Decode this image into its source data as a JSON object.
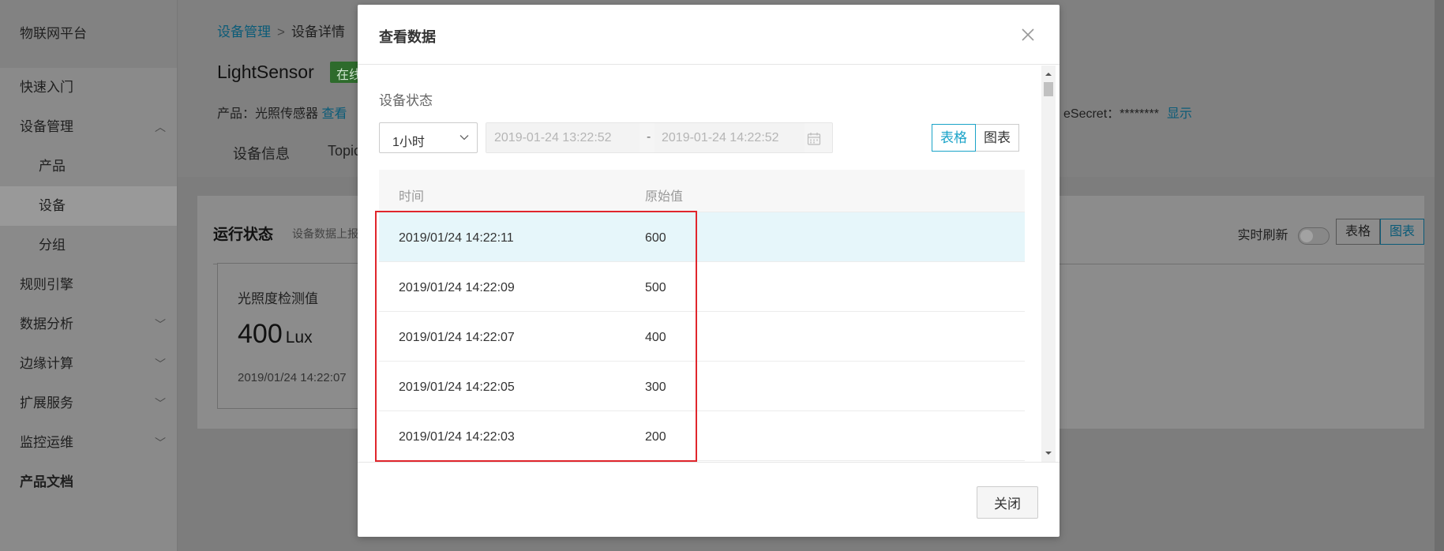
{
  "sidebar": {
    "brand": "物联网平台",
    "items": [
      {
        "label": "快速入门"
      },
      {
        "label": "设备管理"
      },
      {
        "label": "产品"
      },
      {
        "label": "设备"
      },
      {
        "label": "分组"
      },
      {
        "label": "规则引擎"
      },
      {
        "label": "数据分析"
      },
      {
        "label": "边缘计算"
      },
      {
        "label": "扩展服务"
      },
      {
        "label": "监控运维"
      },
      {
        "label": "产品文档"
      }
    ]
  },
  "page": {
    "breadcrumb_root": "设备管理",
    "breadcrumb_sep": ">",
    "breadcrumb_current": "设备详情",
    "device_name": "LightSensor",
    "online_badge": "在线",
    "product_label": "产品：光照传感器",
    "product_link": "查看",
    "secret_label": "eSecret：********",
    "secret_show": "显示",
    "tab_device_info": "设备信息",
    "tab_topic": "Topic"
  },
  "status_panel": {
    "title": "运行状态",
    "subtitle": "设备数据上报",
    "refresh_label": "实时刷新",
    "view_table": "表格",
    "view_chart": "图表",
    "metric_label": "光照度检测值",
    "metric_value": "400",
    "metric_unit": "Lux",
    "metric_time": "2019/01/24 14:22:07"
  },
  "modal": {
    "title": "查看数据",
    "section_label": "设备状态",
    "range_value": "1小时",
    "date_start": "2019-01-24 13:22:52",
    "date_sep": "-",
    "date_end": "2019-01-24 14:22:52",
    "view_table": "表格",
    "view_chart": "图表",
    "columns": [
      "时间",
      "原始值"
    ],
    "rows": [
      {
        "time": "2019/01/24 14:22:11",
        "value": "600"
      },
      {
        "time": "2019/01/24 14:22:09",
        "value": "500"
      },
      {
        "time": "2019/01/24 14:22:07",
        "value": "400"
      },
      {
        "time": "2019/01/24 14:22:05",
        "value": "300"
      },
      {
        "time": "2019/01/24 14:22:03",
        "value": "200"
      }
    ],
    "close_label": "关闭"
  },
  "colors": {
    "accent": "#1aa3c8",
    "highlight_row": "#e6f6fa",
    "annotation_red": "#e0262c"
  }
}
